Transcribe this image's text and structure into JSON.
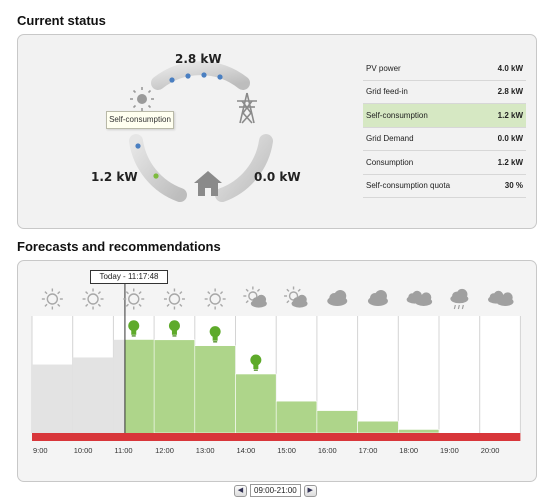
{
  "status": {
    "title": "Current status",
    "top_kw": "2.8 kW",
    "left_kw": "1.2 kW",
    "right_kw": "0.0 kW",
    "tooltip": "Self-consumption",
    "rows": [
      {
        "label": "PV power",
        "value": "4.0 kW",
        "highlight": false
      },
      {
        "label": "Grid feed-in",
        "value": "2.8 kW",
        "highlight": false
      },
      {
        "label": "Self-consumption",
        "value": "1.2 kW",
        "highlight": true
      },
      {
        "label": "Grid Demand",
        "value": "0.0 kW",
        "highlight": false
      },
      {
        "label": "Consumption",
        "value": "1.2 kW",
        "highlight": false
      },
      {
        "label": "Self-consumption quota",
        "value": "30 %",
        "highlight": false
      }
    ],
    "icons": {
      "pv": "sun-icon",
      "grid": "pylon-icon",
      "home": "house-icon"
    },
    "colors": {
      "flow_dot": "#4a7fc1",
      "self_dot": "#7dbb3e"
    }
  },
  "forecast": {
    "title": "Forecasts and recommendations",
    "today_label": "Today - 11:17:48",
    "range_label": "09:00-21:00",
    "prev_label": "◀",
    "next_label": "▶",
    "times": [
      "9:00",
      "10:00",
      "11:00",
      "12:00",
      "13:00",
      "14:00",
      "15:00",
      "16:00",
      "17:00",
      "18:00",
      "19:00",
      "20:00"
    ],
    "weather": [
      "sun",
      "sun",
      "sun",
      "sun",
      "sun",
      "sun-cloud",
      "sun-cloud",
      "cloud",
      "cloud",
      "clouds",
      "rain-cloud",
      "clouds"
    ],
    "colors": {
      "past": "#e3e3e3",
      "future": "#aed58a",
      "bar": "#d8363a",
      "bulb": "#5eaa2a"
    }
  },
  "chart_data": {
    "type": "bar",
    "categories": [
      "9:00",
      "10:00",
      "11:00",
      "12:00",
      "13:00",
      "14:00",
      "15:00",
      "16:00",
      "17:00",
      "18:00",
      "19:00",
      "20:00"
    ],
    "values": [
      0.58,
      0.64,
      0.79,
      0.79,
      0.74,
      0.5,
      0.27,
      0.19,
      0.1,
      0.03,
      0,
      0
    ],
    "recommendations": [
      "11:00",
      "12:00",
      "13:00",
      "14:00"
    ],
    "current_time": "11:17:48",
    "title": "",
    "xlabel": "",
    "ylabel": ""
  }
}
